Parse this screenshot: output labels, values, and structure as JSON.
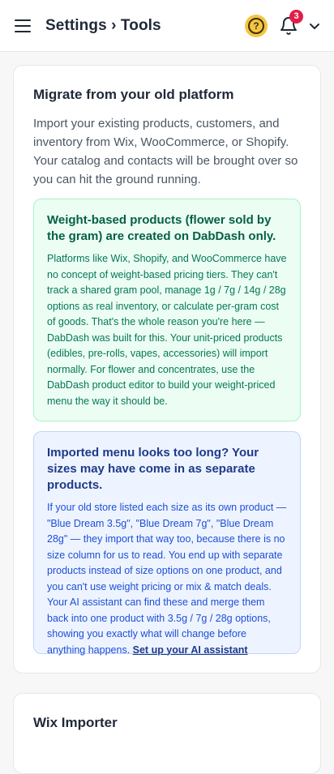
{
  "header": {
    "title": "Settings › Tools",
    "help_icon": "question-circle-icon",
    "help_glyph": "?",
    "notification_count": "3",
    "notification_icon": "bell-icon",
    "menu_icon": "hamburger-icon",
    "account_icon": "chevron-down-icon"
  },
  "migrate": {
    "title": "Migrate from your old platform",
    "description": "Import your existing products, customers, and inventory from Wix, WooCommerce, or Shopify. Your catalog and contacts will be brought over so you can hit the ground running.",
    "weight_note": {
      "title": "Weight-based products (flower sold by the gram) are created on DabDash only.",
      "body": "Platforms like Wix, Shopify, and WooCommerce have no concept of weight-based pricing tiers. They can't track a shared gram pool, manage 1g / 7g / 14g / 28g options as real inventory, or calculate per-gram cost of goods. That's the whole reason you're here — DabDash was built for this. Your unit-priced products (edibles, pre-rolls, vapes, accessories) will import normally. For flower and concentrates, use the DabDash product editor to build your weight-priced menu the way it should be."
    },
    "sizes_note": {
      "title": "Imported menu looks too long? Your sizes may have come in as separate products.",
      "body": "If your old store listed each size as its own product — \"Blue Dream 3.5g\", \"Blue Dream 7g\", \"Blue Dream 28g\" — they import that way too, because there is no size column for us to read. You end up with separate products instead of size options on one product, and you can't use weight pricing or mix & match deals. Your AI assistant can find these and merge them back into one product with 3.5g / 7g / 28g options, showing you exactly what will change before anything happens.",
      "link": "Set up your AI assistant"
    }
  },
  "wix": {
    "title": "Wix Importer"
  },
  "colors": {
    "accent_help": "#f5c542",
    "badge": "#e11d48",
    "green_bg": "#ecfdf3",
    "blue_bg": "#eef4ff"
  }
}
